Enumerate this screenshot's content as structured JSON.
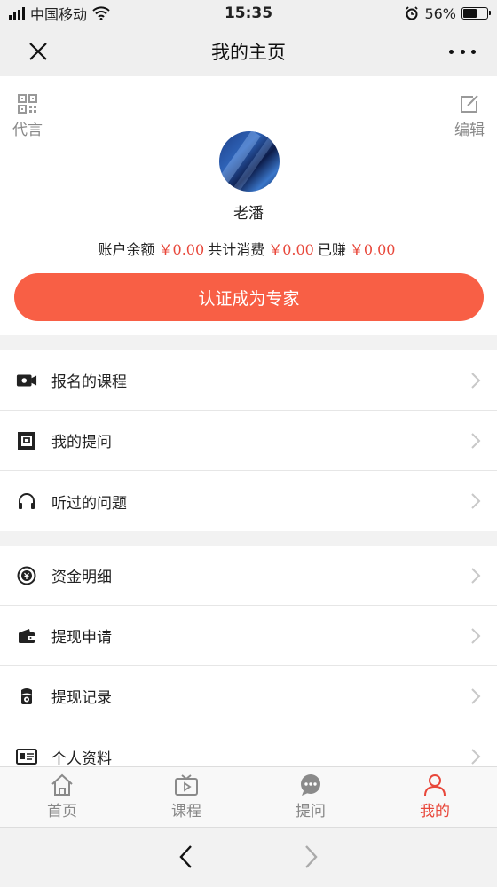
{
  "status_bar": {
    "carrier": "中国移动",
    "time": "15:35",
    "battery": "56%",
    "battery_level": 0.56
  },
  "nav": {
    "title": "我的主页",
    "close_icon": "close-icon",
    "more_icon": "more-icon"
  },
  "profile": {
    "left_action": "代言",
    "right_action": "编辑",
    "name": "老潘",
    "balance_label": "账户余额",
    "balance_value": "￥0.00",
    "spent_label": "共计消费",
    "spent_value": "￥0.00",
    "earned_label": "已赚",
    "earned_value": "￥0.00",
    "cta_label": "认证成为专家"
  },
  "menu_group_1": [
    {
      "label": "报名的课程",
      "icon": "camera-icon"
    },
    {
      "label": "我的提问",
      "icon": "question-icon"
    },
    {
      "label": "听过的问题",
      "icon": "headphones-icon"
    }
  ],
  "menu_group_2": [
    {
      "label": "资金明细",
      "icon": "coin-icon"
    },
    {
      "label": "提现申请",
      "icon": "wallet-icon"
    },
    {
      "label": "提现记录",
      "icon": "record-icon"
    },
    {
      "label": "个人资料",
      "icon": "id-card-icon"
    }
  ],
  "tab_bar": [
    {
      "label": "首页",
      "icon": "home-icon",
      "active": false
    },
    {
      "label": "课程",
      "icon": "tv-icon",
      "active": false
    },
    {
      "label": "提问",
      "icon": "chat-icon",
      "active": false
    },
    {
      "label": "我的",
      "icon": "user-icon",
      "active": true
    }
  ],
  "colors": {
    "accent": "#f85f45",
    "money": "#e8473a",
    "active_tab": "#e8473a",
    "inactive_tab": "#888888"
  }
}
